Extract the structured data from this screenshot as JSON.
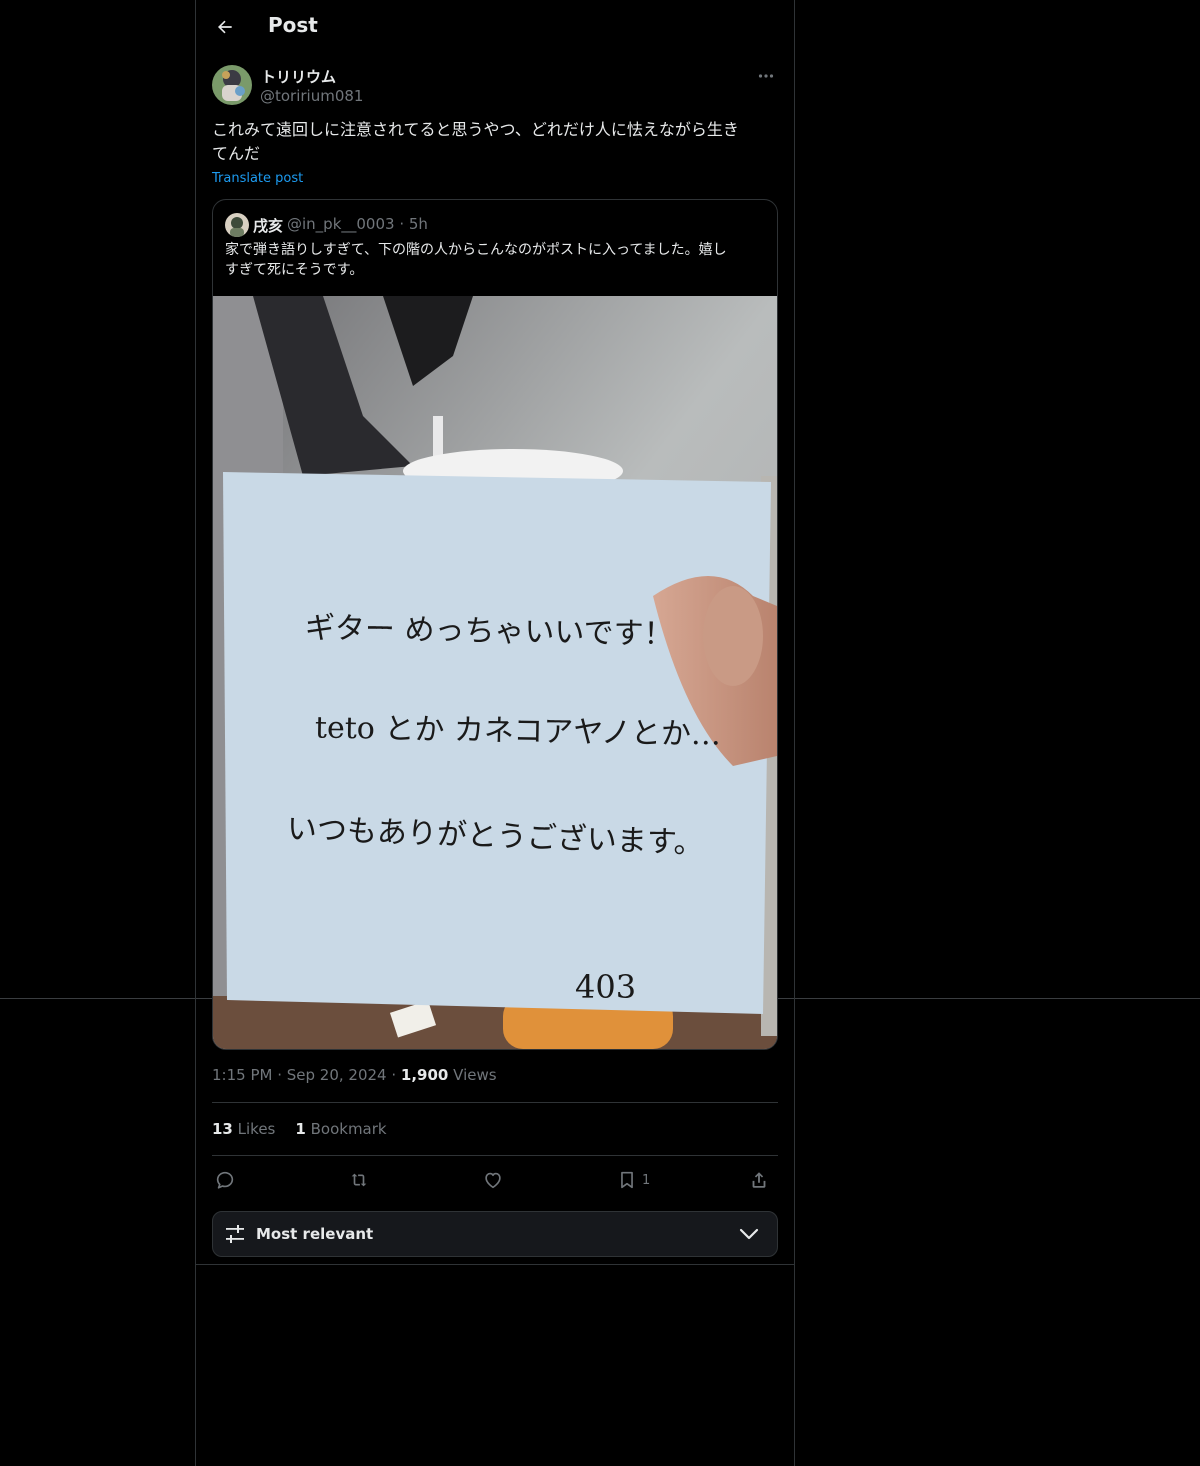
{
  "header": {
    "title": "Post"
  },
  "post": {
    "author_name": "トリリウム",
    "author_handle": "@toririum081",
    "text": "これみて遠回しに注意されてると思うやつ、どれだけ人に怯えながら生き\nてんだ",
    "translate_label": "Translate post",
    "time": "1:15 PM",
    "date": "Sep 20, 2024",
    "views_count": "1,900",
    "views_label": "Views",
    "likes_count": "13",
    "likes_label": "Likes",
    "bookmarks_count": "1",
    "bookmarks_label": "Bookmark"
  },
  "quote": {
    "author_name": "戌亥",
    "author_handle": "@in_pk__0003",
    "age": "5h",
    "text": "家で弾き語りしすぎて、下の階の人からこんなのがポストに入ってました。嬉し\nすぎて死にそうです。",
    "note_lines": [
      "ギター めっちゃいいです！",
      "teto とか カネコアヤノとか…",
      "いつもありがとうございます。",
      "403"
    ]
  },
  "actions": {
    "bookmark_count": "1"
  },
  "sort": {
    "label": "Most relevant"
  },
  "colors": {
    "background": "#000000",
    "text": "#e7e9ea",
    "muted": "#71767b",
    "link": "#1d9bf0",
    "border": "#2f3336",
    "note": "#c9d9e6"
  },
  "icons": [
    "back-arrow-icon",
    "more-icon",
    "reply-icon",
    "retweet-icon",
    "like-icon",
    "bookmark-icon",
    "share-icon",
    "sliders-icon",
    "chevron-down-icon"
  ]
}
